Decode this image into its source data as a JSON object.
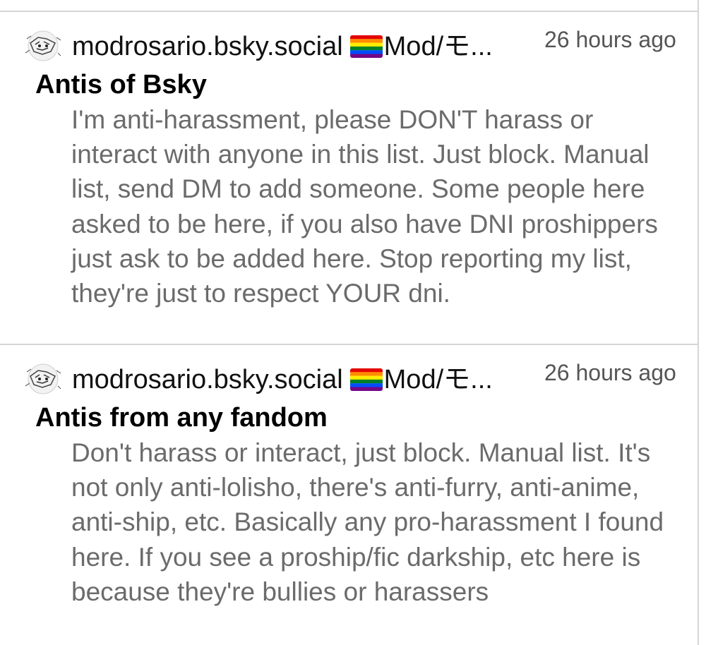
{
  "lists": [
    {
      "handle": "modrosario.bsky.social",
      "flag_icon": "rainbow-flag-icon",
      "display_name": "Mod/モ...",
      "time": "26 hours ago",
      "title": "Antis of Bsky",
      "description": "I'm anti-harassment, please DON'T harass or interact with anyone in this list. Just block. Manual list, send DM to add someone. Some people here asked to be here, if you also have DNI proshippers just ask to be added here. Stop reporting my list, they're just to respect YOUR dni."
    },
    {
      "handle": "modrosario.bsky.social",
      "flag_icon": "rainbow-flag-icon",
      "display_name": "Mod/モ...",
      "time": "26 hours ago",
      "title": "Antis from any fandom",
      "description": "Don't harass or interact, just block. Manual list. It's not only anti-lolisho, there's anti-furry, anti-anime, anti-ship, etc. Basically any pro-harassment I found here. If you see a proship/fic darkship, etc here is because they're bullies or harassers"
    }
  ],
  "colors": {
    "divider": "#d5d5d5",
    "title": "#000000",
    "handle": "#111111",
    "time": "#555555",
    "description": "#6b6b6b"
  }
}
